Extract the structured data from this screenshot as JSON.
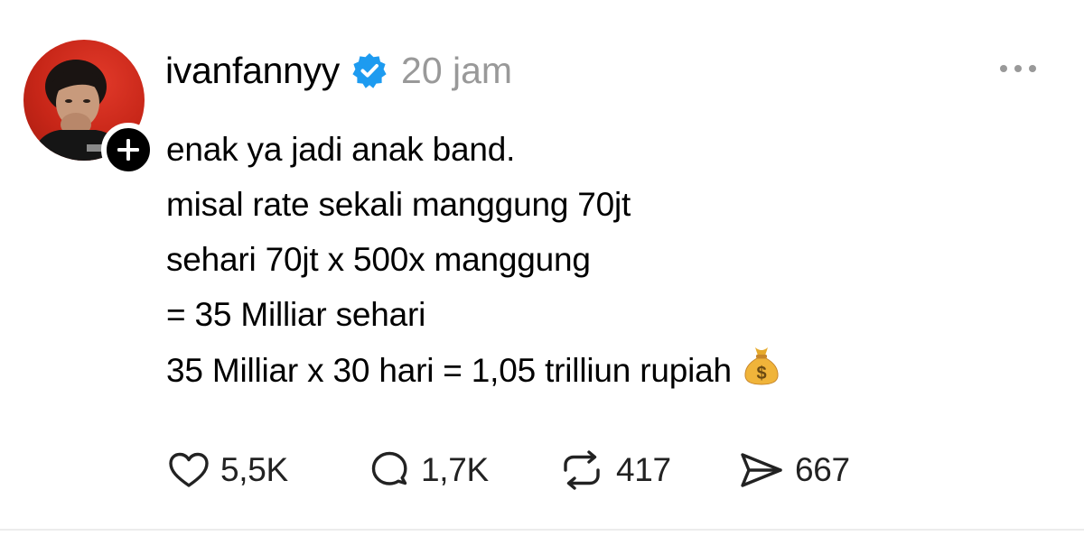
{
  "post": {
    "username": "ivanfannyy",
    "timestamp": "20 jam",
    "lines": [
      "enak ya jadi anak band.",
      "misal rate sekali manggung 70jt",
      "sehari 70jt x 500x manggung",
      "= 35 Milliar sehari",
      "35 Milliar x 30 hari = 1,05 trilliun rupiah"
    ],
    "emoji": "money-bag-icon"
  },
  "actions": {
    "likes": "5,5K",
    "replies": "1,7K",
    "reposts": "417",
    "shares": "667"
  },
  "colors": {
    "verified_blue": "#1d9bf0",
    "muted_text": "#999999",
    "avatar_red": "#c72618"
  }
}
